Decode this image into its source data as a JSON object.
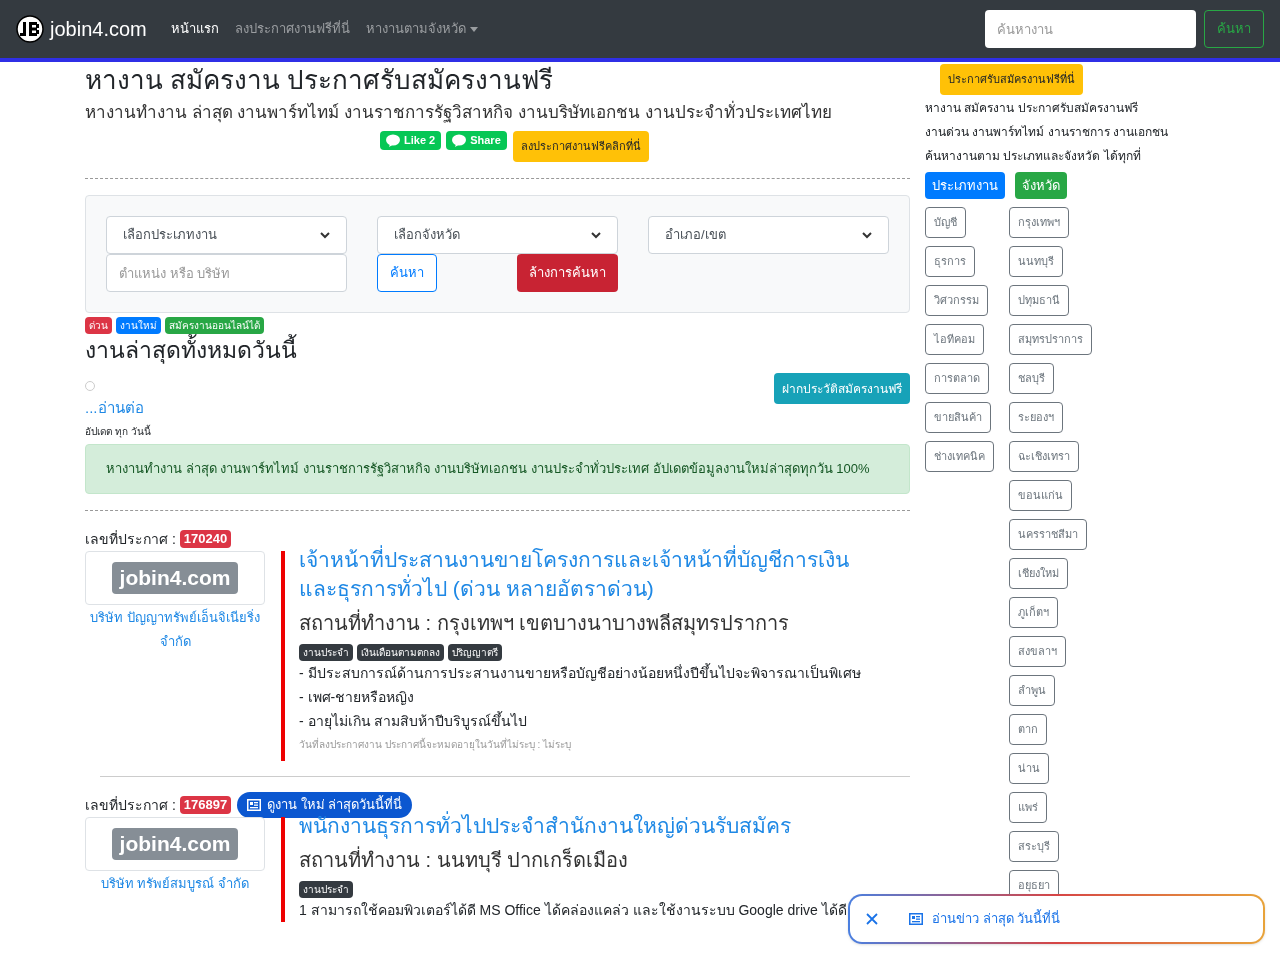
{
  "navbar": {
    "brand": "jobin4.com",
    "links": [
      {
        "label": "หน้าแรก",
        "selected": true,
        "dropdown": false
      },
      {
        "label": "ลงประกาศงานฟรีที่นี่",
        "selected": false,
        "dropdown": false
      },
      {
        "label": "หางานตามจังหวัด",
        "selected": false,
        "dropdown": true
      }
    ],
    "search": {
      "placeholder": "ค้นหางาน"
    },
    "search_button": "ค้นหา"
  },
  "header": {
    "title": "หางาน สมัครงาน ประกาศรับสมัครงานฟรี",
    "subtitle": "หางานทำงาน ล่าสุด งานพาร์ทไทม์ งานราชการรัฐวิสาหกิจ งานบริษัทเอกชน งานประจำทั่วประเทศไทย",
    "like": "Like 2",
    "share": "Share",
    "post_button": "ลงประกาศงานฟรีคลิกที่นี่"
  },
  "filters": {
    "selects": [
      "เลือกประเภทงาน",
      "เลือกจังหวัด",
      "อำเภอ/เขต"
    ],
    "keyword": {
      "placeholder": "ตำแหน่ง หรือ บริษัท"
    },
    "search_button": "ค้นหา",
    "clear_button": "ล้างการค้นหา"
  },
  "badges": [
    {
      "label": "ด่วน",
      "color": "#dc3545"
    },
    {
      "label": "งานใหม่",
      "color": "#007bff"
    },
    {
      "label": "สมัครงานออนไลน์ได้",
      "color": "#28a745"
    }
  ],
  "section": {
    "title": "งานล่าสุดทั้งหมดวันนี้",
    "resume_button": "ฝากประวัติสมัครงานฟรี",
    "more_link": "...อ่านต่อ",
    "note": "อัปเดต ทุก วันนี้",
    "alert": "หางานทำงาน ล่าสุด งานพาร์ทไทม์ งานราชการรัฐวิสาหกิจ งานบริษัทเอกชน งานประจำทั่วประเทศ อัปเดตข้อมูลงานใหม่ล่าสุดทุกวัน 100%"
  },
  "jobs": [
    {
      "id_label": "เลขที่ประกาศ :",
      "id": "170240",
      "logo": "jobin4.com",
      "company": "บริษัท ปัญญาทรัพย์เอ็นจิเนียริ่ง จำกัด",
      "title": "เจ้าหน้าที่ประสานงานขายโครงการและเจ้าหน้าที่บัญชีการเงินและธุรการทั่วไป (ด่วน หลายอัตราด่วน)",
      "location": "สถานที่ทำงาน : กรุงเทพฯ เขตบางนาบางพลีสมุทรปราการ",
      "tags": [
        "งานประจำ",
        "เงินเดือนตามตกลง",
        "ปริญญาตรี"
      ],
      "lines": [
        "- มีประสบการณ์ด้านการประสานงานขายหรือบัญชีอย่างน้อยหนึ่งปีขึ้นไปจะพิจารณาเป็นพิเศษ",
        "- เพศ-ชายหรือหญิง",
        "- อายุไม่เกิน สามสิบห้าปีบริบูรณ์ขึ้นไป"
      ],
      "footer": "วันที่ลงประกาศงาน ประกาศนี้จะหมดอายุในวันที่ไม่ระบุ : ไม่ระบุ"
    },
    {
      "id_label": "เลขที่ประกาศ :",
      "id": "176897",
      "pill": "ดูงาน ใหม่ ล่าสุดวันนี้ที่นี่",
      "logo": "jobin4.com",
      "company": "บริษัท ทรัพย์สมบูรณ์ จำกัด",
      "title": "พนักงานธุรการทั่วไปประจำสำนักงานใหญ่ด่วนรับสมัคร",
      "location": "สถานที่ทำงาน : นนทบุรี ปากเกร็ดเมือง",
      "tags": [
        "งานประจำ"
      ],
      "lines": [
        "1 สามารถใช้คอมพิวเตอร์ได้ดี MS Office ได้คล่องแคล่ว และใช้งานระบบ Google drive ได้ดี"
      ]
    }
  ],
  "sidebar": {
    "post_button": "ประกาศรับสมัครงานฟรีที่นี่",
    "lines": [
      "หางาน สมัครงาน ประกาศรับสมัครงานฟรี",
      "งานด่วน งานพาร์ทไทม์ งานราชการ งานเอกชน",
      "ค้นหางานตาม ประเภทและจังหวัด ได้ทุกที่"
    ],
    "tab_buttons": [
      {
        "label": "ประเภทงาน",
        "color": "#007bff"
      },
      {
        "label": "จังหวัด",
        "color": "#28a745"
      }
    ],
    "categories": [
      "บัญชี",
      "ธุรการ",
      "วิศวกรรม",
      "ไอทีคอม",
      "การตลาด",
      "ขายสินค้า",
      "ช่างเทคนิค"
    ],
    "provinces": [
      "กรุงเทพฯ",
      "นนทบุรี",
      "ปทุมธานี",
      "สมุทรปราการ",
      "ชลบุรี",
      "ระยองฯ",
      "ฉะเชิงเทรา",
      "ขอนแก่น",
      "นครราชสีมา",
      "เชียงใหม่",
      "ภูเก็ตฯ",
      "สงขลาฯ",
      "ลำพูน",
      "ตาก",
      "น่าน",
      "แพร่",
      "สระบุรี",
      "อยุธยา"
    ]
  },
  "floating_bar": {
    "text": "อ่านข่าว ล่าสุด วันนี้ที่นี่"
  }
}
